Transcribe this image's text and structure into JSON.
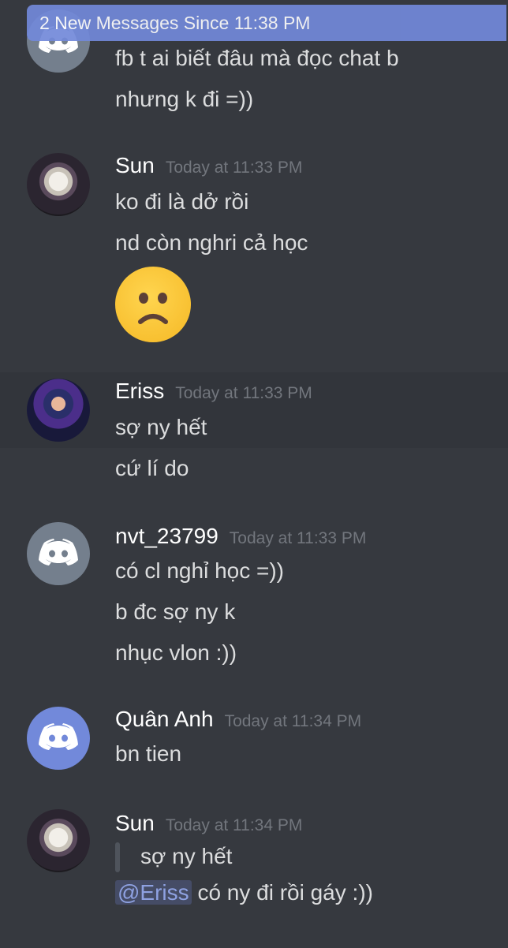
{
  "banner": {
    "text": "2 New Messages Since 11:38 PM"
  },
  "messages": {
    "first": {
      "lines": [
        "fb t ai biết đâu mà đọc chat b",
        "nhưng k đi =))"
      ]
    },
    "sun1": {
      "author": "Sun",
      "time": "Today at 11:33 PM",
      "lines": [
        "ko đi là dở rồi",
        "nd còn nghri cả học"
      ],
      "emoji": "frowning-face"
    },
    "eriss": {
      "author": "Eriss",
      "time": "Today at 11:33 PM",
      "lines": [
        "sợ ny hết",
        "cứ lí do"
      ]
    },
    "nvt": {
      "author": "nvt_23799",
      "time": "Today at 11:33 PM",
      "lines": [
        "có cl nghỉ học =))",
        "b đc sợ ny k",
        "nhục vlon :))"
      ]
    },
    "quananh": {
      "author": "Quân Anh",
      "time": "Today at 11:34 PM",
      "lines": [
        "bn tien"
      ]
    },
    "sun2": {
      "author": "Sun",
      "time": "Today at 11:34 PM",
      "quote": "sợ ny hết",
      "mention": "@Eriss",
      "reply": "có ny đi rồi gáy :))"
    }
  },
  "colors": {
    "background": "#36393f",
    "banner": "#7289da",
    "avatar_grey": "#747f8d",
    "avatar_blurple": "#7289da"
  }
}
